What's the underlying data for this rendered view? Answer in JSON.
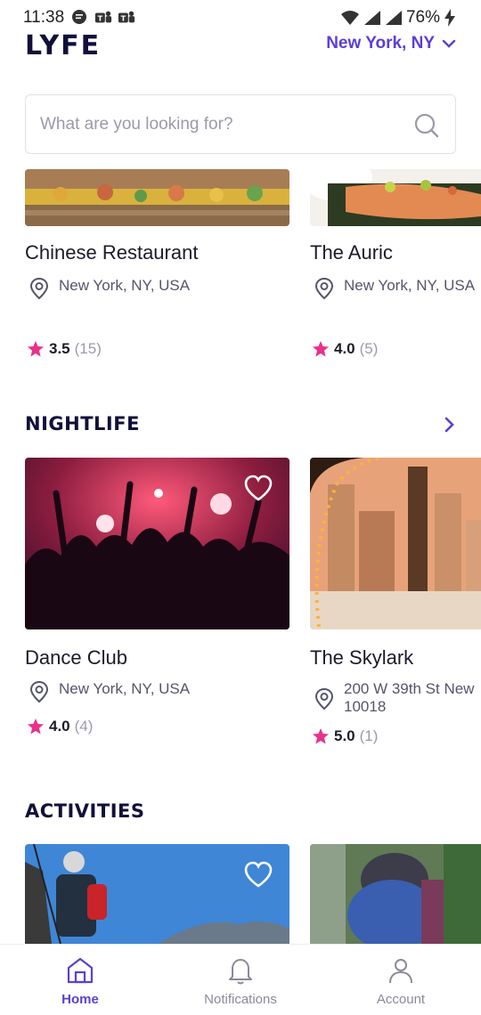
{
  "status_bar": {
    "time": "11:38",
    "battery": "76%",
    "left_icons": [
      "message-icon",
      "teams-icon",
      "teams-icon"
    ],
    "right_icons": [
      "wifi-icon",
      "signal-icon",
      "signal-icon",
      "charging-icon"
    ]
  },
  "header": {
    "logo": "LYFE",
    "location": "New York, NY"
  },
  "search": {
    "placeholder": "What are you looking for?",
    "value": ""
  },
  "top_section": {
    "cards": [
      {
        "name": "Chinese Restaurant",
        "location": "New York, NY, USA",
        "rating": "3.5",
        "count": "(15)"
      },
      {
        "name": "The Auric",
        "location": "New York, NY, USA",
        "rating": "4.0",
        "count": "(5)"
      }
    ]
  },
  "nightlife": {
    "title": "NIGHTLIFE",
    "cards": [
      {
        "name": "Dance Club",
        "location": "New York, NY, USA",
        "rating": "4.0",
        "count": "(4)"
      },
      {
        "name": "The Skylark",
        "location_line1": "200 W 39th St New",
        "location_line2": "10018",
        "rating": "5.0",
        "count": "(1)"
      }
    ]
  },
  "activities": {
    "title": "ACTIVITIES"
  },
  "bottom_nav": {
    "items": [
      {
        "label": "Home",
        "icon": "home-icon",
        "active": true
      },
      {
        "label": "Notifications",
        "icon": "bell-icon",
        "active": false
      },
      {
        "label": "Account",
        "icon": "user-icon",
        "active": false
      }
    ]
  },
  "colors": {
    "accent": "#5b3fd6",
    "star": "#e8328a",
    "title": "#10103a"
  }
}
